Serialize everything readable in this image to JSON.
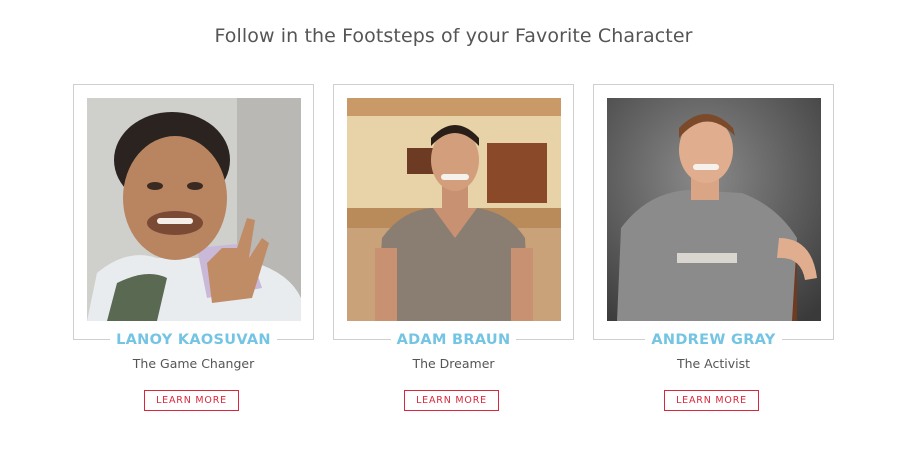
{
  "heading": "Follow in the Footsteps of your Favorite Character",
  "accent_color": "#74c4e3",
  "button_color": "#d9283e",
  "characters": [
    {
      "name": "LANOY KAOSUVAN",
      "role": "The Game Changer",
      "button": "LEARN MORE"
    },
    {
      "name": "ADAM BRAUN",
      "role": "The Dreamer",
      "button": "LEARN MORE"
    },
    {
      "name": "ANDREW GRAY",
      "role": "The Activist",
      "button": "LEARN MORE"
    }
  ]
}
